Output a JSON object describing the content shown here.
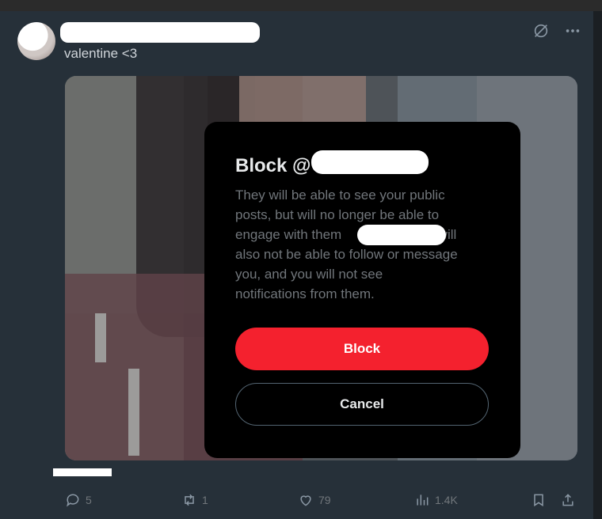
{
  "post": {
    "subtitle": "valentine <3"
  },
  "modal": {
    "title_prefix": "Block @",
    "body_line1": "They will be able to see your public",
    "body_line2": "posts, but will no longer be able to",
    "body_line3_start": "engage with them",
    "body_line3_end": "will",
    "body_line4": "also not be able to follow or message",
    "body_line5": "you, and you will not see",
    "body_line6": "notifications from them.",
    "block_label": "Block",
    "cancel_label": "Cancel"
  },
  "actions": {
    "replies": "5",
    "reposts": "1",
    "likes": "79",
    "views": "1.4K"
  },
  "colors": {
    "block": "#f4212e",
    "background": "#263039",
    "modal": "#000000"
  }
}
